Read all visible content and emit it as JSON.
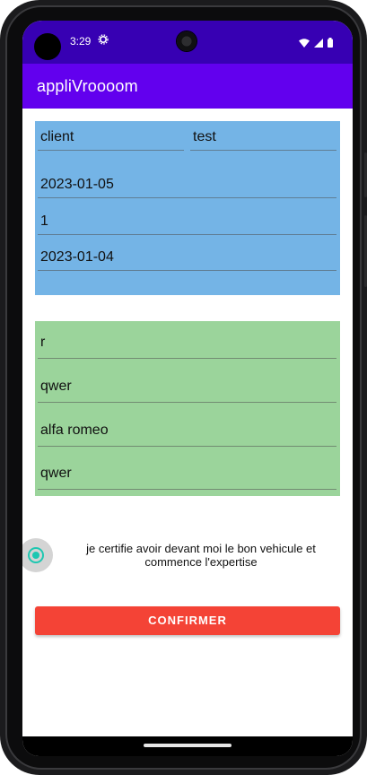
{
  "status_bar": {
    "time": "3:29",
    "settings_icon": "gear-icon",
    "icons": [
      "wifi-icon",
      "signal-icon",
      "battery-icon"
    ],
    "color": "#3700b3"
  },
  "app_bar": {
    "title": "appliVroooom",
    "color": "#6200ee"
  },
  "client_section": {
    "color": "#74b4e6",
    "client_name": "client",
    "client_surname": "test",
    "date_1": "2023-01-05",
    "number": "1",
    "date_2": "2023-01-04"
  },
  "vehicle_section": {
    "color": "#9bd49b",
    "field_1": "r",
    "field_2": "qwer",
    "brand": "alfa romeo",
    "field_4": "qwer"
  },
  "certify": {
    "checked": true,
    "label": "je certifie avoir devant moi le bon vehicule et commence l'expertise",
    "accent": "#1ec7b1"
  },
  "confirm_button": {
    "label": "CONFIRMER",
    "color": "#f44336"
  }
}
